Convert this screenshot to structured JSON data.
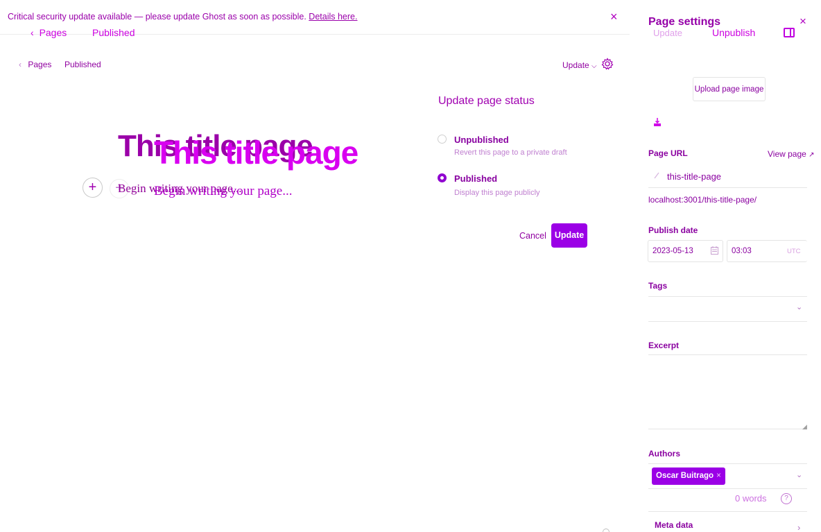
{
  "banner": {
    "message": "Critical security update available — please update Ghost as soon as possible.",
    "link": "Details here.",
    "close_icon": "×"
  },
  "ghost_nav": {
    "back_label": "Pages",
    "status_label": "Published"
  },
  "editor_header": {
    "back_label": "Pages",
    "status_label": "Published",
    "update_menu_label": "Update"
  },
  "editor": {
    "title": "This title page",
    "body_placeholder": "Begin writing your page...",
    "add_card_symbol": "+"
  },
  "status_menu": {
    "heading": "Update page status",
    "options": [
      {
        "title": "Unpublished",
        "description": "Revert this page to a private draft",
        "selected": false
      },
      {
        "title": "Published",
        "description": "Display this page publicly",
        "selected": true
      }
    ],
    "cancel_label": "Cancel",
    "update_label": "Update"
  },
  "settings_panel": {
    "title": "Page settings",
    "close_icon": "×",
    "overlay_update": "Update",
    "overlay_unpublish": "Unpublish",
    "upload_image_label": "Upload page image",
    "page_url_label": "Page URL",
    "view_page_label": "View page",
    "slug": "this-title-page",
    "full_url": "localhost:3001/this-title-page/",
    "publish_date_label": "Publish date",
    "date_value": "2023-05-13",
    "time_value": "03:03",
    "timezone": "UTC",
    "tags_label": "Tags",
    "excerpt_label": "Excerpt",
    "authors_label": "Authors",
    "author_name": "Oscar Buitrago",
    "author_remove_icon": "×",
    "word_count": "0 words",
    "help_symbol": "?",
    "meta_data_label": "Meta data",
    "chevron_down": "⌄",
    "chevron_right": "›"
  },
  "colors": {
    "accent": "#9b00e6",
    "text": "#a000b0",
    "overlay_text": "#cc00e0"
  }
}
